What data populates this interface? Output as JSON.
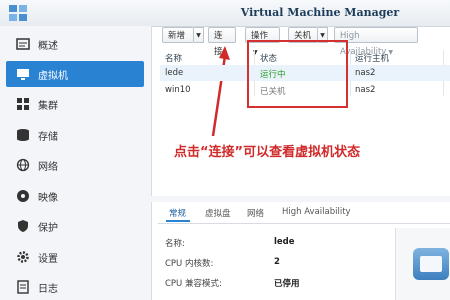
{
  "app": {
    "title": "Virtual Machine Manager"
  },
  "sidebar": {
    "items": [
      {
        "label": "概述",
        "icon": "overview-icon"
      },
      {
        "label": "虚拟机",
        "icon": "vm-icon",
        "active": true
      },
      {
        "label": "集群",
        "icon": "cluster-icon"
      },
      {
        "label": "存储",
        "icon": "storage-icon"
      },
      {
        "label": "网络",
        "icon": "network-icon"
      },
      {
        "label": "映像",
        "icon": "image-icon"
      },
      {
        "label": "保护",
        "icon": "protection-icon"
      },
      {
        "label": "设置",
        "icon": "gear-icon"
      },
      {
        "label": "日志",
        "icon": "log-icon"
      }
    ]
  },
  "toolbar": {
    "new_label": "新增",
    "connect_label": "连接",
    "action_label": "操作",
    "shutdown_label": "关机",
    "ha_label": "High Availability"
  },
  "table": {
    "headers": [
      "名称",
      "状态",
      "运行主机"
    ],
    "rows": [
      {
        "name": "lede",
        "status": "运行中",
        "host": "nas2"
      },
      {
        "name": "win10",
        "status": "已关机",
        "host": "nas2"
      }
    ]
  },
  "annotation": "点击“连接”可以查看虚拟机状态",
  "detail_tabs": [
    "常规",
    "虚拟盘",
    "网络",
    "High Availability"
  ],
  "details": [
    {
      "key": "名称:",
      "value": "lede"
    },
    {
      "key": "CPU 内核数:",
      "value": "2"
    },
    {
      "key": "CPU 兼容模式:",
      "value": "已停用"
    }
  ],
  "colors": {
    "accent": "#2a82d2",
    "running": "#2a9d2a",
    "annotation": "#d02a2a"
  }
}
